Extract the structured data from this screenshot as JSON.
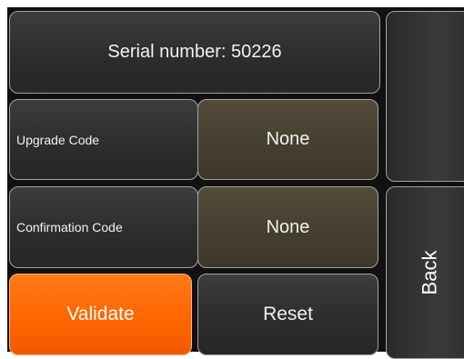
{
  "serial": {
    "text": "Serial number: 50226"
  },
  "upgrade": {
    "label": "Upgrade Code",
    "value": "None"
  },
  "confirmation": {
    "label": "Confirmation Code",
    "value": "None"
  },
  "actions": {
    "validate_label": "Validate",
    "reset_label": "Reset",
    "back_label": "Back"
  },
  "colors": {
    "validate_bg": "#ff6600",
    "value_bg": "#453f31",
    "panel_bg": "#2d2d2d",
    "frame_bg": "#111111"
  }
}
